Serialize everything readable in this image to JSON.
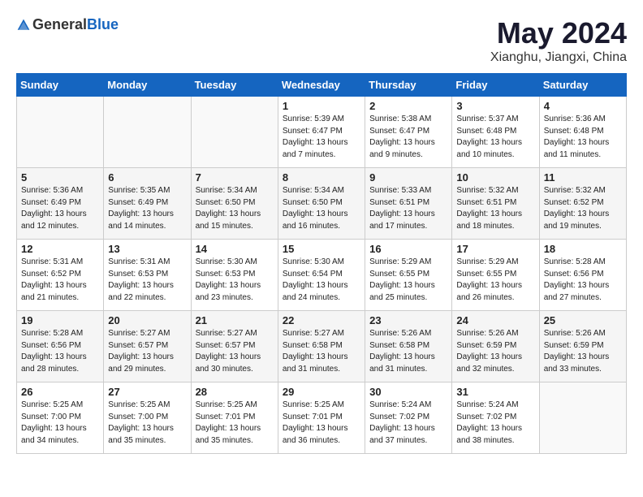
{
  "logo": {
    "general": "General",
    "blue": "Blue"
  },
  "title": "May 2024",
  "location": "Xianghu, Jiangxi, China",
  "weekdays": [
    "Sunday",
    "Monday",
    "Tuesday",
    "Wednesday",
    "Thursday",
    "Friday",
    "Saturday"
  ],
  "weeks": [
    [
      {
        "day": "",
        "info": ""
      },
      {
        "day": "",
        "info": ""
      },
      {
        "day": "",
        "info": ""
      },
      {
        "day": "1",
        "info": "Sunrise: 5:39 AM\nSunset: 6:47 PM\nDaylight: 13 hours\nand 7 minutes."
      },
      {
        "day": "2",
        "info": "Sunrise: 5:38 AM\nSunset: 6:47 PM\nDaylight: 13 hours\nand 9 minutes."
      },
      {
        "day": "3",
        "info": "Sunrise: 5:37 AM\nSunset: 6:48 PM\nDaylight: 13 hours\nand 10 minutes."
      },
      {
        "day": "4",
        "info": "Sunrise: 5:36 AM\nSunset: 6:48 PM\nDaylight: 13 hours\nand 11 minutes."
      }
    ],
    [
      {
        "day": "5",
        "info": "Sunrise: 5:36 AM\nSunset: 6:49 PM\nDaylight: 13 hours\nand 12 minutes."
      },
      {
        "day": "6",
        "info": "Sunrise: 5:35 AM\nSunset: 6:49 PM\nDaylight: 13 hours\nand 14 minutes."
      },
      {
        "day": "7",
        "info": "Sunrise: 5:34 AM\nSunset: 6:50 PM\nDaylight: 13 hours\nand 15 minutes."
      },
      {
        "day": "8",
        "info": "Sunrise: 5:34 AM\nSunset: 6:50 PM\nDaylight: 13 hours\nand 16 minutes."
      },
      {
        "day": "9",
        "info": "Sunrise: 5:33 AM\nSunset: 6:51 PM\nDaylight: 13 hours\nand 17 minutes."
      },
      {
        "day": "10",
        "info": "Sunrise: 5:32 AM\nSunset: 6:51 PM\nDaylight: 13 hours\nand 18 minutes."
      },
      {
        "day": "11",
        "info": "Sunrise: 5:32 AM\nSunset: 6:52 PM\nDaylight: 13 hours\nand 19 minutes."
      }
    ],
    [
      {
        "day": "12",
        "info": "Sunrise: 5:31 AM\nSunset: 6:52 PM\nDaylight: 13 hours\nand 21 minutes."
      },
      {
        "day": "13",
        "info": "Sunrise: 5:31 AM\nSunset: 6:53 PM\nDaylight: 13 hours\nand 22 minutes."
      },
      {
        "day": "14",
        "info": "Sunrise: 5:30 AM\nSunset: 6:53 PM\nDaylight: 13 hours\nand 23 minutes."
      },
      {
        "day": "15",
        "info": "Sunrise: 5:30 AM\nSunset: 6:54 PM\nDaylight: 13 hours\nand 24 minutes."
      },
      {
        "day": "16",
        "info": "Sunrise: 5:29 AM\nSunset: 6:55 PM\nDaylight: 13 hours\nand 25 minutes."
      },
      {
        "day": "17",
        "info": "Sunrise: 5:29 AM\nSunset: 6:55 PM\nDaylight: 13 hours\nand 26 minutes."
      },
      {
        "day": "18",
        "info": "Sunrise: 5:28 AM\nSunset: 6:56 PM\nDaylight: 13 hours\nand 27 minutes."
      }
    ],
    [
      {
        "day": "19",
        "info": "Sunrise: 5:28 AM\nSunset: 6:56 PM\nDaylight: 13 hours\nand 28 minutes."
      },
      {
        "day": "20",
        "info": "Sunrise: 5:27 AM\nSunset: 6:57 PM\nDaylight: 13 hours\nand 29 minutes."
      },
      {
        "day": "21",
        "info": "Sunrise: 5:27 AM\nSunset: 6:57 PM\nDaylight: 13 hours\nand 30 minutes."
      },
      {
        "day": "22",
        "info": "Sunrise: 5:27 AM\nSunset: 6:58 PM\nDaylight: 13 hours\nand 31 minutes."
      },
      {
        "day": "23",
        "info": "Sunrise: 5:26 AM\nSunset: 6:58 PM\nDaylight: 13 hours\nand 31 minutes."
      },
      {
        "day": "24",
        "info": "Sunrise: 5:26 AM\nSunset: 6:59 PM\nDaylight: 13 hours\nand 32 minutes."
      },
      {
        "day": "25",
        "info": "Sunrise: 5:26 AM\nSunset: 6:59 PM\nDaylight: 13 hours\nand 33 minutes."
      }
    ],
    [
      {
        "day": "26",
        "info": "Sunrise: 5:25 AM\nSunset: 7:00 PM\nDaylight: 13 hours\nand 34 minutes."
      },
      {
        "day": "27",
        "info": "Sunrise: 5:25 AM\nSunset: 7:00 PM\nDaylight: 13 hours\nand 35 minutes."
      },
      {
        "day": "28",
        "info": "Sunrise: 5:25 AM\nSunset: 7:01 PM\nDaylight: 13 hours\nand 35 minutes."
      },
      {
        "day": "29",
        "info": "Sunrise: 5:25 AM\nSunset: 7:01 PM\nDaylight: 13 hours\nand 36 minutes."
      },
      {
        "day": "30",
        "info": "Sunrise: 5:24 AM\nSunset: 7:02 PM\nDaylight: 13 hours\nand 37 minutes."
      },
      {
        "day": "31",
        "info": "Sunrise: 5:24 AM\nSunset: 7:02 PM\nDaylight: 13 hours\nand 38 minutes."
      },
      {
        "day": "",
        "info": ""
      }
    ]
  ]
}
